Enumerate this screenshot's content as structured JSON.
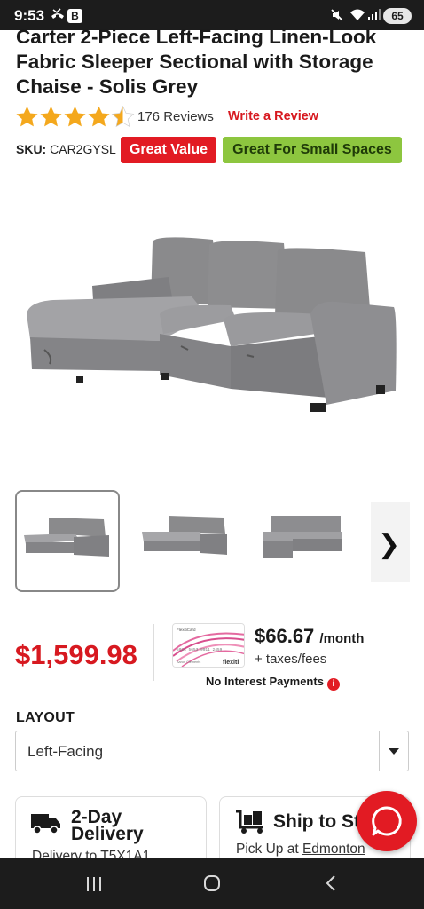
{
  "status_bar": {
    "time": "9:53",
    "app_badge": "B",
    "battery": "65"
  },
  "product": {
    "title": "Carter 2-Piece Left-Facing Linen-Look Fabric Sleeper Sectional with Storage Chaise - Solis Grey",
    "rating_stars": 4.5,
    "reviews_label": "176 Reviews",
    "write_review_label": "Write a Review",
    "sku_label": "SKU:",
    "sku_value": "CAR2GYSL",
    "badges": [
      "Great Value",
      "Great For Small Spaces"
    ]
  },
  "gallery": {
    "thumbnail_count_visible": 3,
    "active_index": 0,
    "next_icon": "chevron-right-icon"
  },
  "pricing": {
    "price": "$1,599.98",
    "monthly_amount": "$66.67",
    "monthly_unit": "/month",
    "taxes_note": "+ taxes/fees",
    "no_interest_label": "No Interest Payments",
    "card": {
      "brand_top": "FlexitiCard",
      "number": "5024 5653 9011 2459",
      "holder": "Aaron Clements",
      "logo": "flexiti"
    }
  },
  "layout_option": {
    "label": "LAYOUT",
    "selected": "Left-Facing"
  },
  "fulfillment": {
    "delivery_title_line1": "2-Day",
    "delivery_title_line2": "Delivery",
    "delivery_sub": "Delivery to T5X1A1",
    "ship_title": "Ship to Store",
    "ship_sub_prefix": "Pick Up at",
    "ship_sub_link": "Edmonton"
  },
  "colors": {
    "brand_red": "#e21b23",
    "badge_green": "#8dc63f",
    "text_dark": "#1a1a1a"
  }
}
